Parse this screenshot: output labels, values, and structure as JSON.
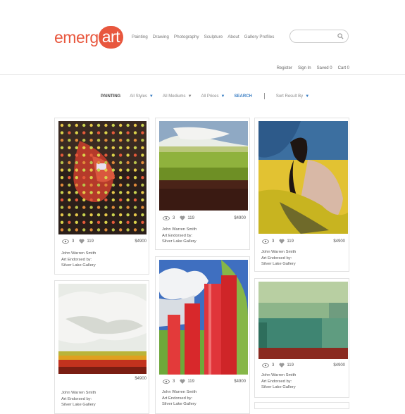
{
  "brand": {
    "part1": "emerg",
    "part2": "art"
  },
  "nav": [
    "Painting",
    "Drawing",
    "Photography",
    "Sculpture",
    "About",
    "Gallery Profiles"
  ],
  "utility": [
    "Register",
    "Sign In",
    "Saved 0",
    "Cart 0"
  ],
  "filters": {
    "category": "PAINTING",
    "styles": "All Styles",
    "mediums": "All Mediums",
    "prices": "All Prices",
    "search": "SEARCH",
    "sort": "Sort Result By"
  },
  "cards": [
    {
      "views": "3",
      "likes": "119",
      "price": "$4900",
      "artist": "John Warren Smith",
      "endorsed": "Art Endorsed by:",
      "gallery": "Silver Lake Gallery"
    },
    {
      "views": "3",
      "likes": "119",
      "price": "$4900",
      "artist": "John Warren Smith",
      "endorsed": "Art Endorsed by:",
      "gallery": "Silver Lake Gallery"
    },
    {
      "views": "3",
      "likes": "119",
      "price": "$4900",
      "artist": "John Warren Smith",
      "endorsed": "Art Endorsed by:",
      "gallery": "Silver Lake Gallery"
    },
    {
      "views": "",
      "likes": "",
      "price": "$4900",
      "artist": "John Warren Smith",
      "endorsed": "Art Endorsed by:",
      "gallery": "Silver Lake Gallery"
    },
    {
      "views": "3",
      "likes": "119",
      "price": "$4900",
      "artist": "John Warren Smith",
      "endorsed": "Art Endorsed by:",
      "gallery": "Silver Lake Gallery"
    },
    {
      "views": "3",
      "likes": "119",
      "price": "$4900",
      "artist": "John Warren Smith",
      "endorsed": "Art Endorsed by:",
      "gallery": "Silver Lake Gallery"
    }
  ],
  "colors": {
    "brand": "#e8573e",
    "accent": "#3c7fc4"
  }
}
